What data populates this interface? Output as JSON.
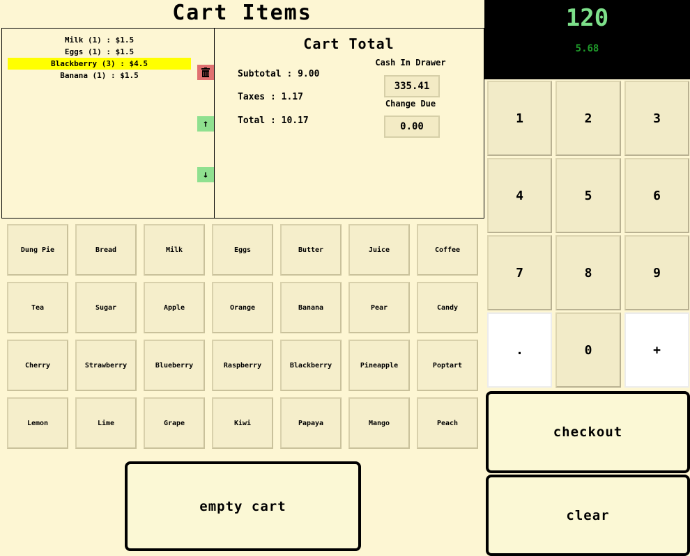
{
  "header": {
    "title": "Cart Items"
  },
  "cart": {
    "items": [
      {
        "label": "Milk (1) : $1.5",
        "selected": false
      },
      {
        "label": "Eggs (1) : $1.5",
        "selected": false
      },
      {
        "label": "Blackberry (3) : $4.5",
        "selected": true
      },
      {
        "label": "Banana (1) : $1.5",
        "selected": false
      }
    ],
    "delete_icon": "trash-icon",
    "up_icon": "↑",
    "down_icon": "↓"
  },
  "totals": {
    "title": "Cart Total",
    "subtotal": "Subtotal : 9.00",
    "taxes": "Taxes : 1.17",
    "total": "Total : 10.17",
    "cash_label": "Cash In Drawer",
    "cash_value": "335.41",
    "change_label": "Change Due",
    "change_value": "0.00"
  },
  "products": [
    "Dung Pie",
    "Bread",
    "Milk",
    "Eggs",
    "Butter",
    "Juice",
    "Coffee",
    "Tea",
    "Sugar",
    "Apple",
    "Orange",
    "Banana",
    "Pear",
    "Candy",
    "Cherry",
    "Strawberry",
    "Blueberry",
    "Raspberry",
    "Blackberry",
    "Pineapple",
    "Poptart",
    "Lemon",
    "Lime",
    "Grape",
    "Kiwi",
    "Papaya",
    "Mango",
    "Peach"
  ],
  "actions": {
    "empty_cart": "empty cart",
    "checkout": "checkout",
    "clear": "clear"
  },
  "display": {
    "main": "120",
    "sub": "5.68"
  },
  "keypad": [
    "1",
    "2",
    "3",
    "4",
    "5",
    "6",
    "7",
    "8",
    "9",
    ".",
    "0",
    "+"
  ],
  "colors": {
    "background": "#fdf6d3",
    "selected": "#ffff00",
    "delete": "#e07070",
    "arrow": "#8fe08f",
    "display_main": "#7de08a",
    "display_sub": "#1f9a2a"
  }
}
